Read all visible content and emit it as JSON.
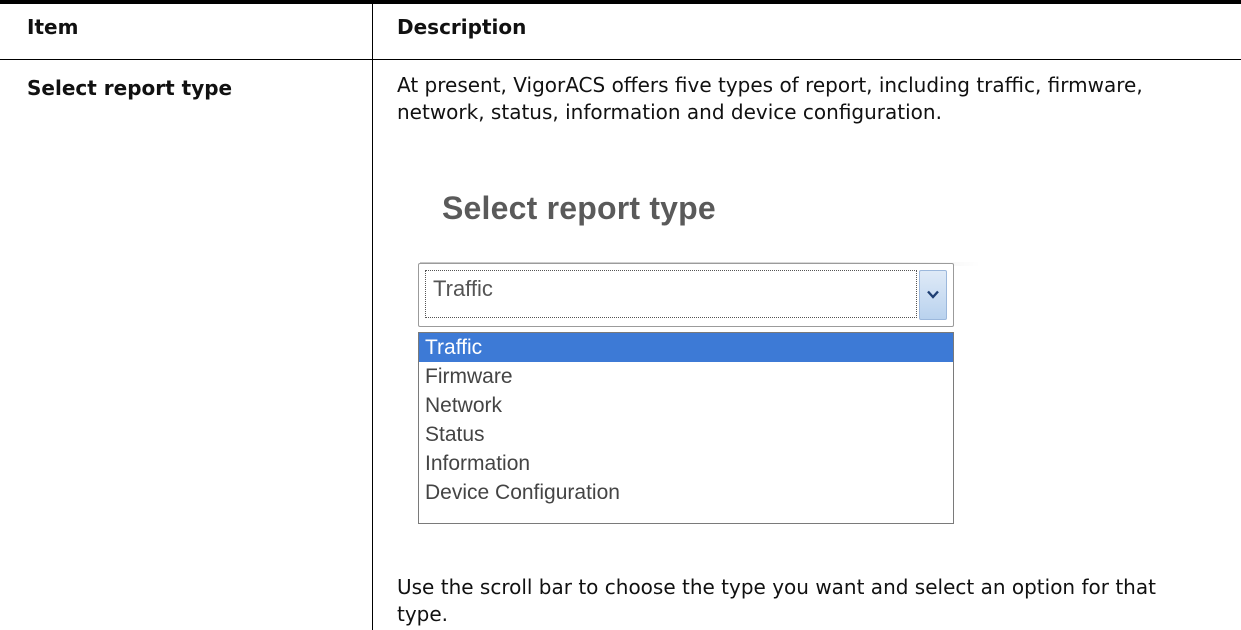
{
  "table": {
    "header": {
      "item": "Item",
      "description": "Description"
    },
    "row": {
      "item": "Select report type",
      "description": "At present, VigorACS offers five types of report, including traffic, firmware, network, status, information and device configuration.",
      "note": "Use the scroll bar to choose the type you want and select an option for that type."
    }
  },
  "figure": {
    "title": "Select report type",
    "select_value": "Traffic",
    "options": [
      "Traffic",
      "Firmware",
      "Network",
      "Status",
      "Information",
      "Device Configuration"
    ],
    "selected_index": 0,
    "colors": {
      "highlight": "#3d7ad6",
      "title": "#5a5a5a"
    }
  }
}
